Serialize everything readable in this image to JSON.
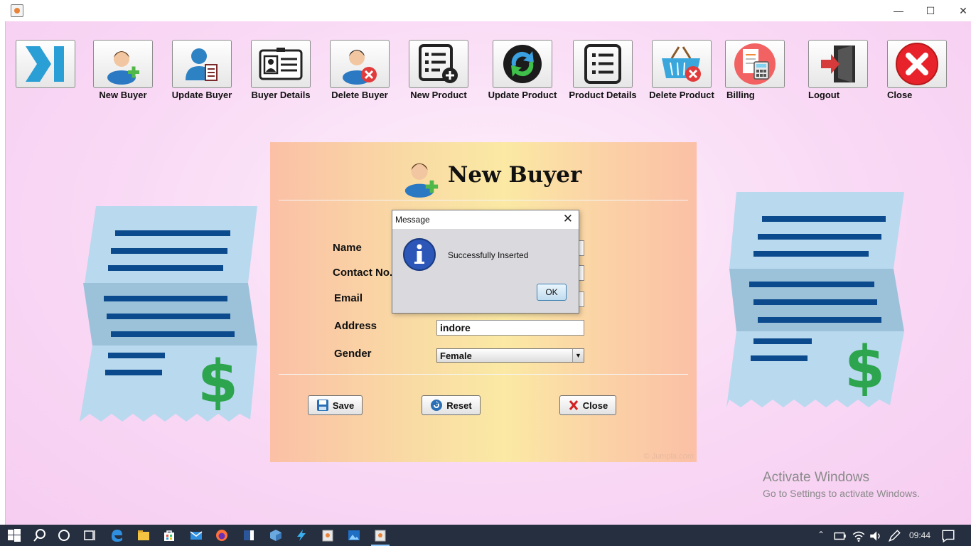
{
  "window": {
    "minimize": "—",
    "maximize": "☐",
    "close": "✕"
  },
  "toolbar": {
    "items": [
      {
        "label": "",
        "icon": "collapse-icon"
      },
      {
        "label": "New Buyer",
        "icon": "user-add-icon"
      },
      {
        "label": "Update Buyer",
        "icon": "user-edit-icon"
      },
      {
        "label": "Buyer Details",
        "icon": "id-card-icon"
      },
      {
        "label": "Delete Buyer",
        "icon": "user-delete-icon"
      },
      {
        "label": "New Product",
        "icon": "list-add-icon"
      },
      {
        "label": "Update Product",
        "icon": "refresh-icon"
      },
      {
        "label": "Product Details",
        "icon": "list-icon"
      },
      {
        "label": "Delete Product",
        "icon": "basket-delete-icon"
      },
      {
        "label": "Billing",
        "icon": "calculator-icon"
      },
      {
        "label": "Logout",
        "icon": "exit-door-icon"
      },
      {
        "label": "Close",
        "icon": "close-circle-icon"
      }
    ]
  },
  "receipt": {
    "symbol": "$",
    "lines_color": "#0b4a8c",
    "symbol_color": "#2da44e"
  },
  "form": {
    "title": "New Buyer",
    "fields": {
      "name": {
        "label": "Name",
        "value": ""
      },
      "contact": {
        "label": "Contact No.",
        "value": ""
      },
      "email": {
        "label": "Email",
        "value": ""
      },
      "address": {
        "label": "Address",
        "value": "indore"
      },
      "gender": {
        "label": "Gender",
        "value": "Female"
      }
    },
    "buttons": {
      "save": "Save",
      "reset": "Reset",
      "close": "Close"
    },
    "watermark": "© Jumpla.com"
  },
  "dialog": {
    "title": "Message",
    "message": "Successfully Inserted",
    "ok": "OK"
  },
  "activate": {
    "line1": "Activate Windows",
    "line2": "Go to Settings to activate Windows."
  },
  "taskbar": {
    "time": "09:44"
  }
}
